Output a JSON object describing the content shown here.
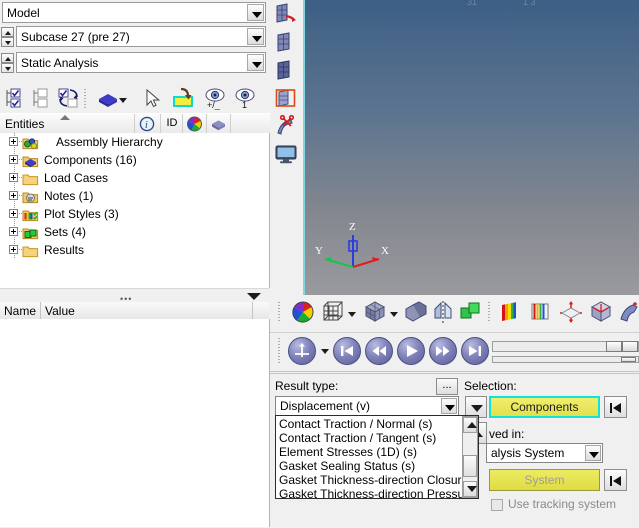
{
  "left_panel": {
    "combos": [
      {
        "value": "Model",
        "has_spinner": false
      },
      {
        "value": "Subcase 27 (pre 27)",
        "has_spinner": true
      },
      {
        "value": "Static Analysis",
        "has_spinner": true
      }
    ],
    "toolbar_icons": [
      "check-all-icon",
      "uncheck-all-icon",
      "reverse-check-icon",
      "component-color-icon",
      "component-color-dropdown-icon",
      "pointer-select-icon",
      "display-color-icon",
      "visibility-toggle-icon",
      "visibility-single-icon"
    ],
    "entities_header": {
      "title": "Entities",
      "collapse_caret": "caret-up-icon",
      "columns": [
        "info-icon",
        "ID",
        "color-wheel-icon",
        "box-icon"
      ]
    },
    "tree_items": [
      {
        "label": "Assembly Hierarchy",
        "icon": "assembly-icon",
        "expandable": true,
        "indent": true
      },
      {
        "label": "Components (16)",
        "icon": "components-icon",
        "expandable": true,
        "indent": false
      },
      {
        "label": "Load Cases",
        "icon": "folder-icon",
        "expandable": true,
        "indent": false
      },
      {
        "label": "Notes (1)",
        "icon": "notes-icon",
        "expandable": true,
        "indent": false
      },
      {
        "label": "Plot Styles (3)",
        "icon": "plotstyles-icon",
        "expandable": true,
        "indent": false
      },
      {
        "label": "Sets  (4)",
        "icon": "sets-icon",
        "expandable": true,
        "indent": false
      },
      {
        "label": "Results",
        "icon": "folder-icon",
        "expandable": true,
        "indent": false
      }
    ],
    "splitter": {
      "grip": "•••",
      "collapse_icon": "caret-down-icon"
    },
    "property_grid": {
      "columns": [
        "Name",
        "Value"
      ],
      "rows": []
    }
  },
  "viewport": {
    "toolbar_icons": [
      "page-next-icon",
      "page-icon",
      "page-solid-icon",
      "page-selected-icon",
      "scissors-icon",
      "monitor-icon"
    ],
    "axis_triad": {
      "z_label": "Z",
      "y_label": "Y",
      "x_label": "X",
      "z_color": "#2a3ce0",
      "y_color": "#13c64a",
      "x_color": "#e01d1d"
    },
    "background_top": "#3d5f85",
    "background_bottom": "#9a9a9e",
    "highlight_border": "#7fd8e0"
  },
  "display_bar": {
    "icons": [
      "color-wheel-icon",
      "wireframe-cube-icon",
      "wireframe-cube-dropdown-icon",
      "shaded-cube-icon",
      "shaded-cube-dropdown-icon",
      "feature-lines-icon",
      "symmetry-icon",
      "exploded-view-icon",
      "contour-icon",
      "iso-value-icon",
      "vector-icon",
      "tensor-icon",
      "trace-icon",
      "note-icon"
    ]
  },
  "animation_bar": {
    "buttons": [
      "animation-mode-icon",
      "animation-mode-dropdown-icon",
      "first-frame-icon",
      "rewind-icon",
      "play-icon",
      "fast-forward-icon",
      "last-frame-icon"
    ],
    "sliders": [
      {
        "name": "frame-slider",
        "thumb_pos_pct": 92
      },
      {
        "name": "speed-slider",
        "thumb_pos_pct": 93
      }
    ]
  },
  "result_panel": {
    "result_type_label": "Result type:",
    "advanced_button": "...",
    "result_type_value": "Displacement (v)",
    "dropdown_open": true,
    "dropdown_options": [
      "Contact Traction / Normal (s)",
      "Contact Traction / Tangent (s)",
      "Element Stresses (1D) (s)",
      "Gasket Sealing Status (s)",
      "Gasket Thickness-direction Closure (s)",
      "Gasket Thickness-direction Pressure (s)"
    ],
    "selection_label": "Selection:",
    "selection_value": "Components",
    "selection_dropdown_icon": "caret-down-icon",
    "selection_prev_icon": "jump-to-start-icon",
    "resolved_in_label": "ved in:",
    "resolved_in_value": "alysis System",
    "system_button": "System",
    "system_prev_icon": "jump-to-start-icon",
    "tracking_checkbox_label": "Use tracking system",
    "tracking_checked": false,
    "tracking_disabled": true,
    "accent_yellow": "#e6e44f",
    "accent_cyan": "#12e3d8"
  }
}
